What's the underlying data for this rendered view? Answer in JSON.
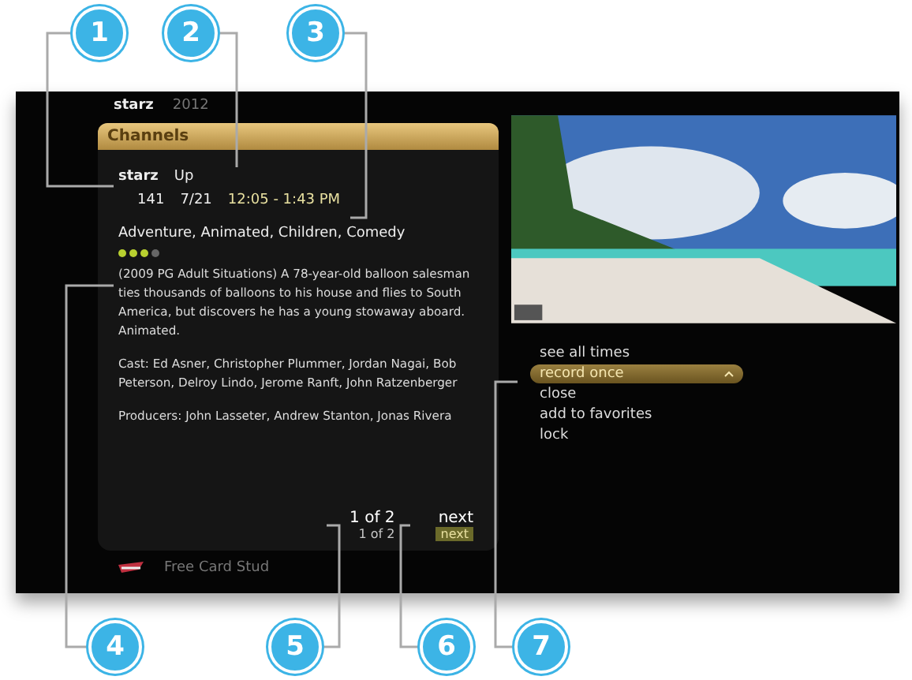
{
  "callouts": [
    {
      "number": "1"
    },
    {
      "number": "2"
    },
    {
      "number": "3"
    },
    {
      "number": "4"
    },
    {
      "number": "5"
    },
    {
      "number": "6"
    },
    {
      "number": "7"
    }
  ],
  "header": {
    "logo": "starz",
    "year": "2012"
  },
  "channel_bar": "Channels",
  "program": {
    "logo": "starz",
    "title": "Up",
    "channel": "141",
    "date": "7/21",
    "time": "12:05 - 1:43 PM",
    "genres": "Adventure, Animated, Children, Comedy",
    "stars": 3,
    "description": "(2009 PG Adult Situations) A 78-year-old balloon salesman ties thousands of balloons to his house and flies to South America, but discovers he has a young stowaway aboard. Animated.",
    "cast": "Cast: Ed Asner, Christopher Plummer, Jordan Nagai, Bob Peterson, Delroy Lindo, Jerome Ranft, John Ratzenberger",
    "producers": "Producers: John Lasseter, Andrew Stanton, Jonas Rivera"
  },
  "pager": {
    "caption": "1 of 2",
    "value": "1 of 2"
  },
  "next": {
    "caption": "next",
    "button": "next"
  },
  "next_program": "Free Card Stud",
  "menu": [
    {
      "label": "see all times",
      "selected": false
    },
    {
      "label": "record once",
      "selected": true
    },
    {
      "label": "close",
      "selected": false
    },
    {
      "label": "add to favorites",
      "selected": false
    },
    {
      "label": "lock",
      "selected": false
    }
  ]
}
